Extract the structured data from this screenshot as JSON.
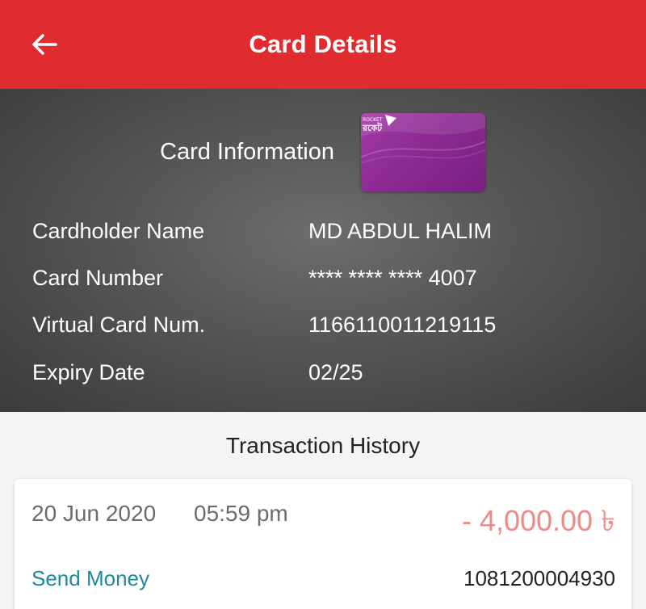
{
  "header": {
    "title": "Card Details",
    "back_icon": "arrow-left-icon",
    "color": "#e02c2f"
  },
  "card_info": {
    "title": "Card Information",
    "card_image_icon": "card-image",
    "card_color": "#8d2a92",
    "rows": [
      {
        "label": "Cardholder Name",
        "value": "MD ABDUL HALIM"
      },
      {
        "label": "Card Number",
        "value": "**** **** **** 4007"
      },
      {
        "label": "Virtual Card Num.",
        "value": "1166110011219115"
      },
      {
        "label": "Expiry Date",
        "value": "02/25"
      }
    ]
  },
  "transactions": {
    "title": "Transaction History",
    "items": [
      {
        "date": "20 Jun 2020",
        "time": "05:59 pm",
        "amount": "- 4,000.00 ৳",
        "type": "Send Money",
        "txn_id": "1081200004930",
        "amount_color": "#f08a86",
        "type_color": "#1a8a9e"
      }
    ]
  }
}
